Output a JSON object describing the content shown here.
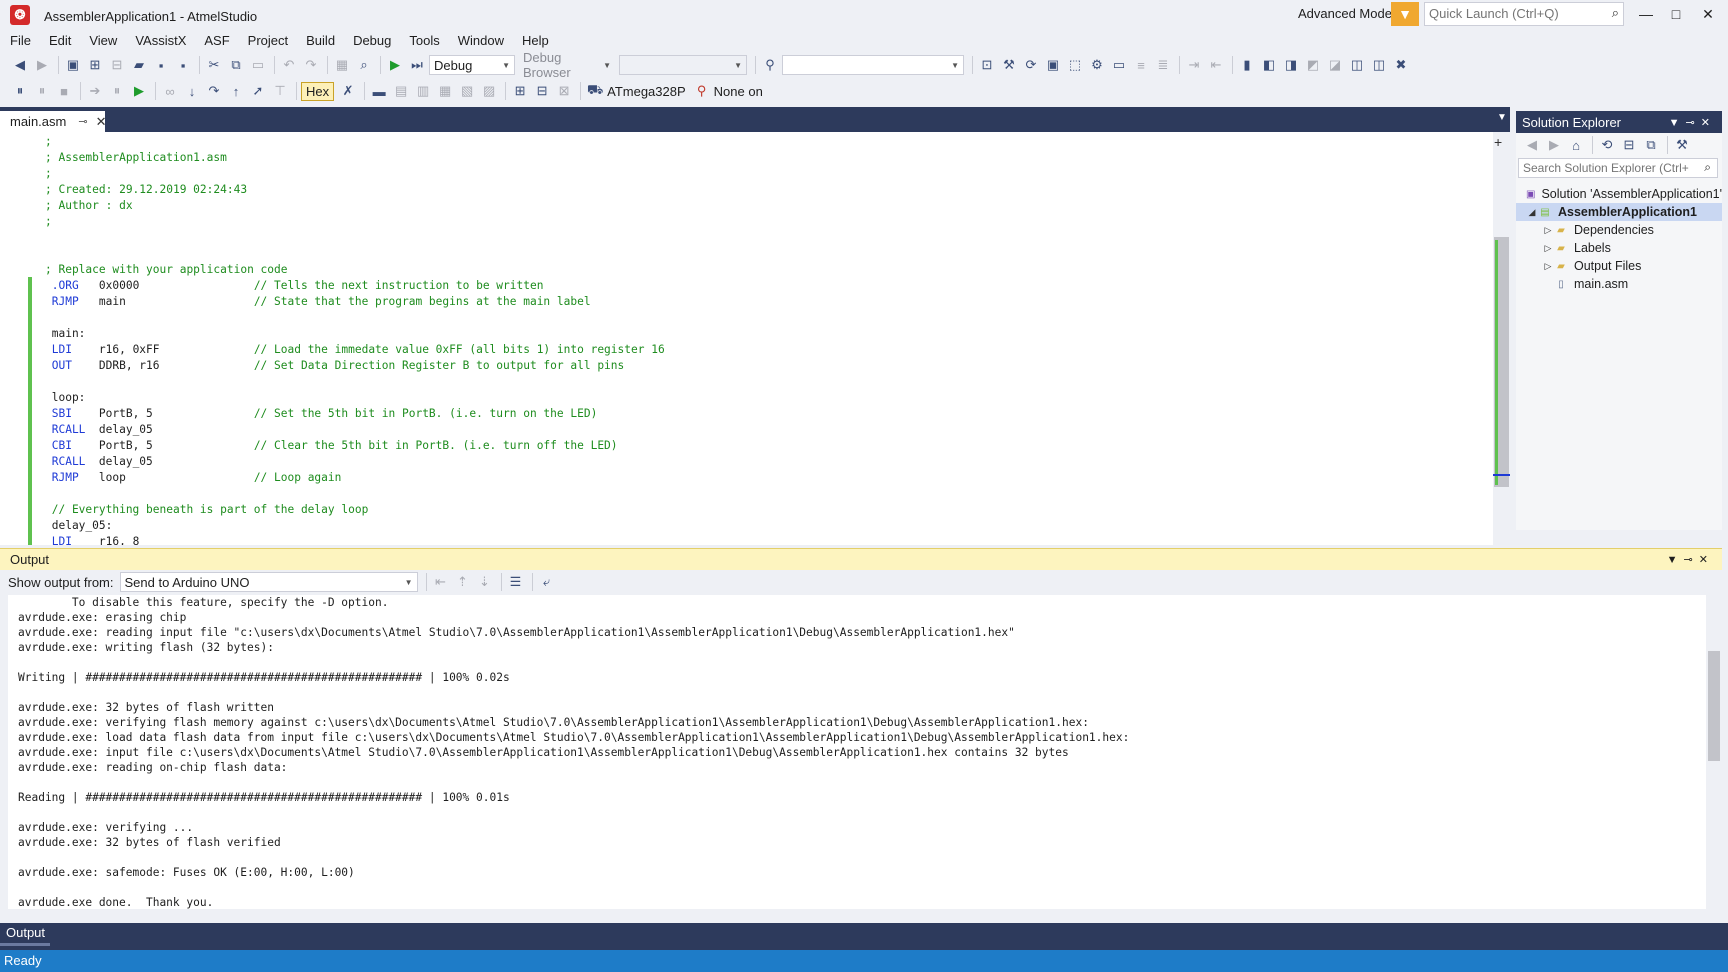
{
  "window": {
    "title": "AssemblerApplication1 - AtmelStudio",
    "logo_glyph": "❂",
    "advanced_mode": "Advanced Mode",
    "quick_launch_placeholder": "Quick Launch (Ctrl+Q)"
  },
  "menu": [
    "File",
    "Edit",
    "View",
    "VAssistX",
    "ASF",
    "Project",
    "Build",
    "Debug",
    "Tools",
    "Window",
    "Help"
  ],
  "toolbar": {
    "configuration": "Debug",
    "debug_browser": "Debug Browser",
    "hex_label": "Hex",
    "device": "ATmega328P",
    "tool": "None on"
  },
  "editor": {
    "tab_title": "main.asm",
    "code_lines": [
      [
        {
          "c": "com",
          "t": ";"
        }
      ],
      [
        {
          "c": "com",
          "t": "; AssemblerApplication1.asm"
        }
      ],
      [
        {
          "c": "com",
          "t": ";"
        }
      ],
      [
        {
          "c": "com",
          "t": "; Created: 29.12.2019 02:24:43"
        }
      ],
      [
        {
          "c": "com",
          "t": "; Author : dx"
        }
      ],
      [
        {
          "c": "com",
          "t": ";"
        }
      ],
      [],
      [],
      [
        {
          "c": "com",
          "t": "; Replace with your application code"
        }
      ],
      [
        {
          "c": "kw",
          "t": " .ORG"
        },
        {
          "c": "txt",
          "t": "   0x0000                 "
        },
        {
          "c": "com",
          "t": "// Tells the next instruction to be written"
        }
      ],
      [
        {
          "c": "kw",
          "t": " RJMP"
        },
        {
          "c": "txt",
          "t": "   main                   "
        },
        {
          "c": "com",
          "t": "// State that the program begins at the main label"
        }
      ],
      [],
      [
        {
          "c": "txt",
          "t": " main:"
        }
      ],
      [
        {
          "c": "kw",
          "t": " LDI"
        },
        {
          "c": "txt",
          "t": "    r16, 0xFF              "
        },
        {
          "c": "com",
          "t": "// Load the immedate value 0xFF (all bits 1) into register 16"
        }
      ],
      [
        {
          "c": "kw",
          "t": " OUT"
        },
        {
          "c": "txt",
          "t": "    DDRB, r16              "
        },
        {
          "c": "com",
          "t": "// Set Data Direction Register B to output for all pins"
        }
      ],
      [],
      [
        {
          "c": "txt",
          "t": " loop:"
        }
      ],
      [
        {
          "c": "kw",
          "t": " SBI"
        },
        {
          "c": "txt",
          "t": "    PortB, 5               "
        },
        {
          "c": "com",
          "t": "// Set the 5th bit in PortB. (i.e. turn on the LED)"
        }
      ],
      [
        {
          "c": "kw",
          "t": " RCALL"
        },
        {
          "c": "txt",
          "t": "  delay_05"
        }
      ],
      [
        {
          "c": "kw",
          "t": " CBI"
        },
        {
          "c": "txt",
          "t": "    PortB, 5               "
        },
        {
          "c": "com",
          "t": "// Clear the 5th bit in PortB. (i.e. turn off the LED)"
        }
      ],
      [
        {
          "c": "kw",
          "t": " RCALL"
        },
        {
          "c": "txt",
          "t": "  delay_05"
        }
      ],
      [
        {
          "c": "kw",
          "t": " RJMP"
        },
        {
          "c": "txt",
          "t": "   loop                   "
        },
        {
          "c": "com",
          "t": "// Loop again"
        }
      ],
      [],
      [
        {
          "c": "com",
          "t": " // Everything beneath is part of the delay loop"
        }
      ],
      [
        {
          "c": "txt",
          "t": " delay_05:"
        }
      ],
      [
        {
          "c": "kw",
          "t": " LDI"
        },
        {
          "c": "txt",
          "t": "    r16, 8"
        }
      ]
    ]
  },
  "solution_explorer": {
    "title": "Solution Explorer",
    "search_placeholder": "Search Solution Explorer (Ctrl+",
    "items": [
      {
        "label": "Solution 'AssemblerApplication1'",
        "level": 0,
        "expander": "",
        "icon": "▣",
        "icon_color": "#7b4bb5",
        "bold": false,
        "selected": false
      },
      {
        "label": "AssemblerApplication1",
        "level": 0,
        "expander": "◢",
        "icon": "▤",
        "icon_color": "#7bbf3a",
        "bold": true,
        "selected": true
      },
      {
        "label": "Dependencies",
        "level": 1,
        "expander": "▷",
        "icon": "▰",
        "icon_color": "#d8b34a",
        "bold": false,
        "selected": false
      },
      {
        "label": "Labels",
        "level": 1,
        "expander": "▷",
        "icon": "▰",
        "icon_color": "#d8b34a",
        "bold": false,
        "selected": false
      },
      {
        "label": "Output Files",
        "level": 1,
        "expander": "▷",
        "icon": "▰",
        "icon_color": "#d8b34a",
        "bold": false,
        "selected": false
      },
      {
        "label": "main.asm",
        "level": 1,
        "expander": "",
        "icon": "▯",
        "icon_color": "#5a6a8a",
        "bold": false,
        "selected": false
      }
    ]
  },
  "output": {
    "title": "Output",
    "show_from_label": "Show output from:",
    "source": "Send to Arduino UNO",
    "lines": [
      "        To disable this feature, specify the -D option.",
      "avrdude.exe: erasing chip",
      "avrdude.exe: reading input file \"c:\\users\\dx\\Documents\\Atmel Studio\\7.0\\AssemblerApplication1\\AssemblerApplication1\\Debug\\AssemblerApplication1.hex\"",
      "avrdude.exe: writing flash (32 bytes):",
      "",
      "Writing | ################################################## | 100% 0.02s",
      "",
      "avrdude.exe: 32 bytes of flash written",
      "avrdude.exe: verifying flash memory against c:\\users\\dx\\Documents\\Atmel Studio\\7.0\\AssemblerApplication1\\AssemblerApplication1\\Debug\\AssemblerApplication1.hex:",
      "avrdude.exe: load data flash data from input file c:\\users\\dx\\Documents\\Atmel Studio\\7.0\\AssemblerApplication1\\AssemblerApplication1\\Debug\\AssemblerApplication1.hex:",
      "avrdude.exe: input file c:\\users\\dx\\Documents\\Atmel Studio\\7.0\\AssemblerApplication1\\AssemblerApplication1\\Debug\\AssemblerApplication1.hex contains 32 bytes",
      "avrdude.exe: reading on-chip flash data:",
      "",
      "Reading | ################################################## | 100% 0.01s",
      "",
      "avrdude.exe: verifying ...",
      "avrdude.exe: 32 bytes of flash verified",
      "",
      "avrdude.exe: safemode: Fuses OK (E:00, H:00, L:00)",
      "",
      "avrdude.exe done.  Thank you."
    ],
    "bottom_tab": "Output"
  },
  "status": {
    "text": "Ready"
  },
  "colors": {
    "accent_blue": "#1e7cc8",
    "tab_strip": "#2d3a5c",
    "output_title": "#fdf4bf",
    "comment_green": "#1e8c1e",
    "keyword_blue": "#1f3bd6"
  }
}
